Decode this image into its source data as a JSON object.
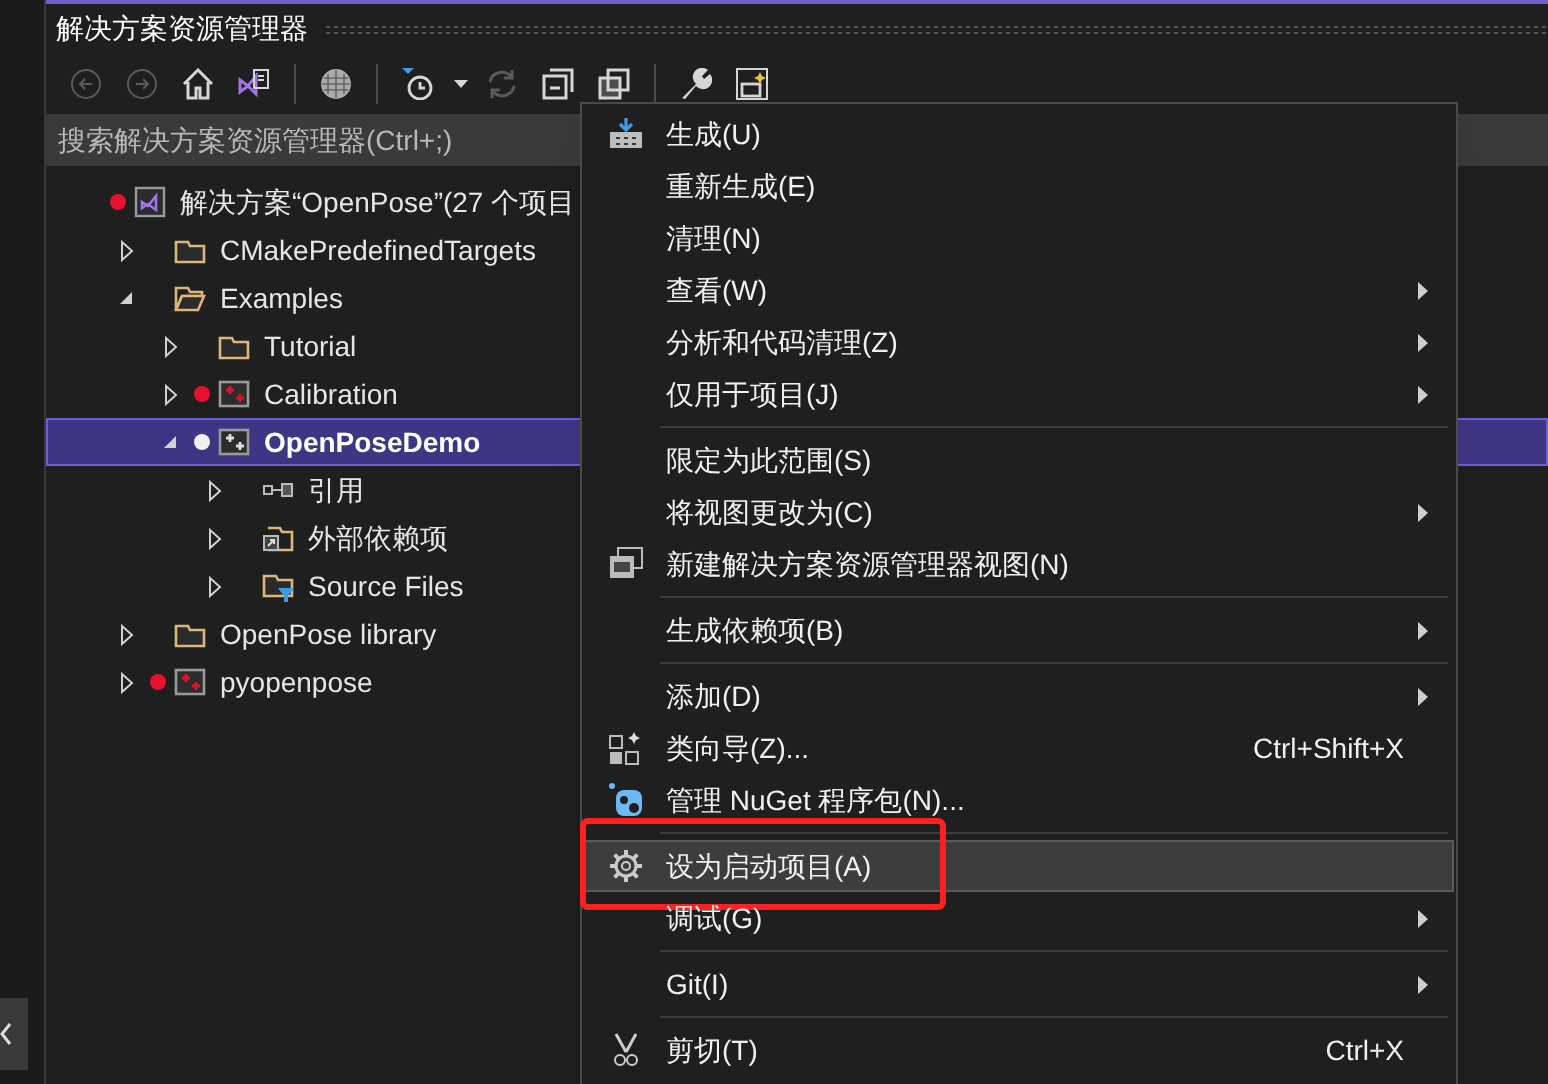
{
  "panel": {
    "title": "解决方案资源管理器",
    "search": {
      "placeholder": "搜索解决方案资源管理器(Ctrl+;)"
    }
  },
  "toolbar": [
    {
      "kind": "back",
      "disabled": true
    },
    {
      "kind": "forward",
      "disabled": true
    },
    {
      "kind": "home",
      "disabled": false
    },
    {
      "kind": "switch_view",
      "disabled": false
    },
    {
      "kind": "separator"
    },
    {
      "kind": "globe",
      "disabled": false
    },
    {
      "kind": "separator"
    },
    {
      "kind": "pending_changes",
      "disabled": false
    },
    {
      "kind": "dropdown",
      "disabled": false
    },
    {
      "kind": "refresh",
      "disabled": true
    },
    {
      "kind": "collapse_all",
      "disabled": false
    },
    {
      "kind": "copy",
      "disabled": false
    },
    {
      "kind": "separator"
    },
    {
      "kind": "properties",
      "disabled": false
    },
    {
      "kind": "preview",
      "disabled": false
    }
  ],
  "solution": {
    "label": "解决方案“OpenPose”(27 个项目",
    "color": "#e8112d"
  },
  "tree": [
    {
      "label": "CMakePredefinedTargets",
      "kind": "folder",
      "expanded": false,
      "selected": false
    },
    {
      "label": "Examples",
      "kind": "folder",
      "expanded": true,
      "selected": false,
      "children": [
        {
          "label": "Tutorial",
          "kind": "folder",
          "expanded": false,
          "selected": false
        },
        {
          "label": "Calibration",
          "kind": "project",
          "expanded": false,
          "selected": false,
          "color": "#e8112d"
        },
        {
          "label": "OpenPoseDemo",
          "kind": "project",
          "expanded": true,
          "selected": true,
          "color": "#f0f0f0",
          "children": [
            {
              "label": "引用",
              "kind": "references",
              "expanded": false,
              "selected": false
            },
            {
              "label": "外部依赖项",
              "kind": "external",
              "expanded": false,
              "selected": false
            },
            {
              "label": "Source Files",
              "kind": "filter_folder",
              "expanded": false,
              "selected": false
            }
          ]
        }
      ]
    },
    {
      "label": "OpenPose library",
      "kind": "folder",
      "expanded": false,
      "selected": false
    },
    {
      "label": "pyopenpose",
      "kind": "project",
      "expanded": false,
      "selected": false,
      "color": "#e8112d"
    }
  ],
  "context_menu": [
    {
      "kind": "item",
      "label": "生成(U)",
      "submenu": false,
      "selected": false,
      "annotated": false
    },
    {
      "kind": "item",
      "label": "重新生成(E)",
      "submenu": false,
      "selected": false,
      "annotated": false
    },
    {
      "kind": "item",
      "label": "清理(N)",
      "submenu": false,
      "selected": false,
      "annotated": false
    },
    {
      "kind": "item",
      "label": "查看(W)",
      "submenu": true,
      "selected": false,
      "annotated": false
    },
    {
      "kind": "item",
      "label": "分析和代码清理(Z)",
      "submenu": true,
      "selected": false,
      "annotated": false
    },
    {
      "kind": "item",
      "label": "仅用于项目(J)",
      "submenu": true,
      "selected": false,
      "annotated": false
    },
    {
      "kind": "separator"
    },
    {
      "kind": "item",
      "label": "限定为此范围(S)",
      "submenu": false,
      "selected": false,
      "annotated": false
    },
    {
      "kind": "item",
      "label": "将视图更改为(C)",
      "submenu": true,
      "selected": false,
      "annotated": false
    },
    {
      "kind": "item",
      "label": "新建解决方案资源管理器视图(N)",
      "submenu": false,
      "selected": false,
      "annotated": false
    },
    {
      "kind": "separator"
    },
    {
      "kind": "item",
      "label": "生成依赖项(B)",
      "submenu": true,
      "selected": false,
      "annotated": false
    },
    {
      "kind": "separator"
    },
    {
      "kind": "item",
      "label": "添加(D)",
      "submenu": true,
      "selected": false,
      "annotated": false
    },
    {
      "kind": "item",
      "label": "类向导(Z)...",
      "shortcut": "Ctrl+Shift+X",
      "submenu": false,
      "selected": false,
      "annotated": false
    },
    {
      "kind": "item",
      "label": "管理 NuGet 程序包(N)...",
      "submenu": false,
      "selected": false,
      "annotated": false
    },
    {
      "kind": "separator"
    },
    {
      "kind": "item",
      "label": "设为启动项目(A)",
      "submenu": false,
      "selected": true,
      "annotated": true
    },
    {
      "kind": "item",
      "label": "调试(G)",
      "submenu": true,
      "selected": false,
      "annotated": false
    },
    {
      "kind": "separator"
    },
    {
      "kind": "item",
      "label": "Git(I)",
      "submenu": true,
      "selected": false,
      "annotated": false
    },
    {
      "kind": "separator"
    },
    {
      "kind": "item",
      "label": "剪切(T)",
      "shortcut": "Ctrl+X",
      "submenu": false,
      "selected": false,
      "annotated": false
    }
  ]
}
